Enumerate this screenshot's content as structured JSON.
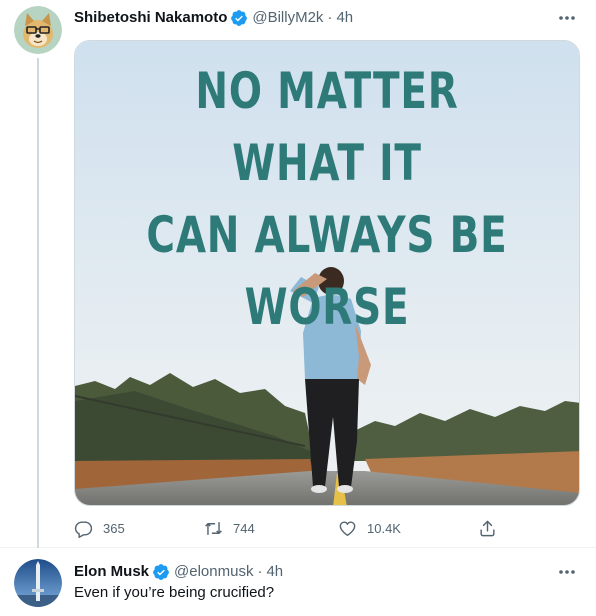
{
  "tweets": [
    {
      "author": {
        "name": "Shibetoshi Nakamoto",
        "handle": "@BillyM2k",
        "verified": true
      },
      "separator": "·",
      "time": "4h",
      "media": {
        "caption_lines": [
          "NO MATTER WHAT IT",
          "CAN ALWAYS BE",
          "WORSE"
        ]
      },
      "actions": {
        "replies": "365",
        "retweets": "744",
        "likes": "10.4K"
      }
    },
    {
      "author": {
        "name": "Elon Musk",
        "handle": "@elonmusk",
        "verified": true
      },
      "separator": "·",
      "time": "4h",
      "text": "Even if you’re being crucified?"
    }
  ],
  "icons": {
    "more": "more-horizontal-icon",
    "verified": "verified-badge-icon",
    "reply": "reply-icon",
    "retweet": "retweet-icon",
    "like": "heart-icon",
    "share": "share-icon"
  },
  "colors": {
    "verified": "#1d9bf0",
    "muted_text": "#536471",
    "meme_text": "#2e7a78",
    "thread_line": "#cfd9de"
  }
}
